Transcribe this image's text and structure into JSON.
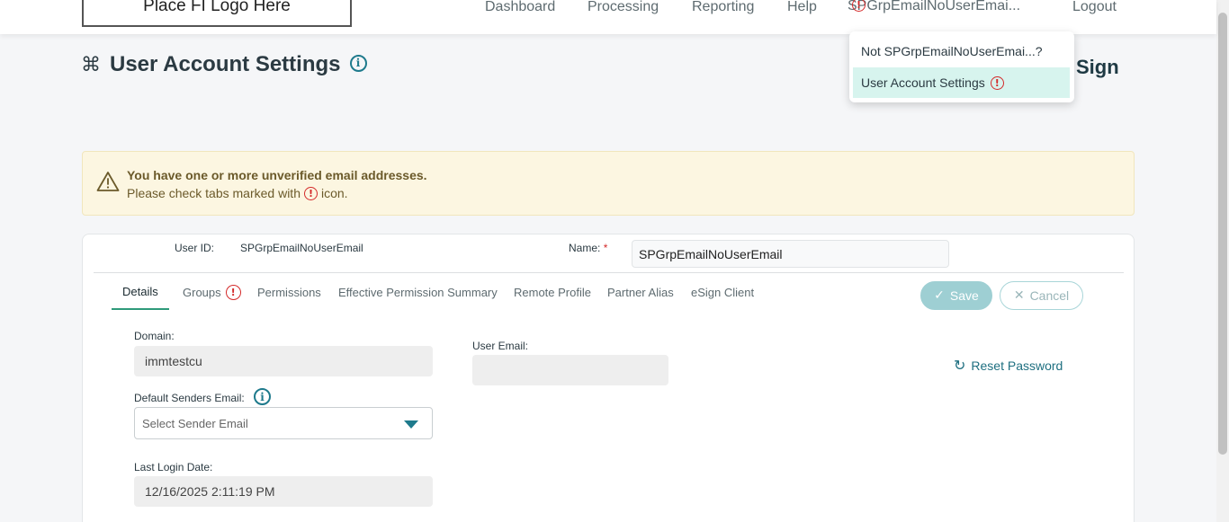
{
  "header": {
    "logo_text": "Place FI Logo Here",
    "nav": {
      "dashboard": "Dashboard",
      "processing": "Processing",
      "reporting": "Reporting",
      "help": "Help",
      "user": "SPGrpEmailNoUserEmai...",
      "logout": "Logout"
    },
    "warning_glyph": "!"
  },
  "dropdown": {
    "not_user": "Not SPGrpEmailNoUserEmai...?",
    "account_settings": "User Account Settings"
  },
  "page": {
    "title": "User Account Settings",
    "info_glyph": "i",
    "sign_text": "Sign"
  },
  "alert": {
    "line1": "You have one or more unverified email addresses.",
    "line2_before": "Please check tabs marked with",
    "line2_after": "icon."
  },
  "user": {
    "id_label": "User ID:",
    "id_value": "SPGrpEmailNoUserEmail",
    "name_label": "Name:",
    "required_mark": "*",
    "name_value": "SPGrpEmailNoUserEmail"
  },
  "tabs": [
    {
      "label": "Details"
    },
    {
      "label": "Groups"
    },
    {
      "label": "Permissions"
    },
    {
      "label": "Effective Permission Summary"
    },
    {
      "label": "Remote Profile"
    },
    {
      "label": "Partner Alias"
    },
    {
      "label": "eSign Client"
    }
  ],
  "actions": {
    "save_label": "Save",
    "cancel_label": "Cancel",
    "reset_password": "Reset Password"
  },
  "details": {
    "domain_label": "Domain:",
    "domain_value": "immtestcu",
    "default_sender_label": "Default Senders Email:",
    "sender_placeholder": "Select Sender Email",
    "last_login_label": "Last Login Date:",
    "last_login_value": "12/16/2025 2:11:19 PM",
    "user_email_label": "User Email:",
    "user_email_value": ""
  },
  "colors": {
    "accent": "#1e7a8c",
    "active_tab_underline": "#2f9a7a",
    "warning": "#d42a2a",
    "alert_bg": "#fcf6e1",
    "dropdown_highlight": "#d7f4ee"
  }
}
